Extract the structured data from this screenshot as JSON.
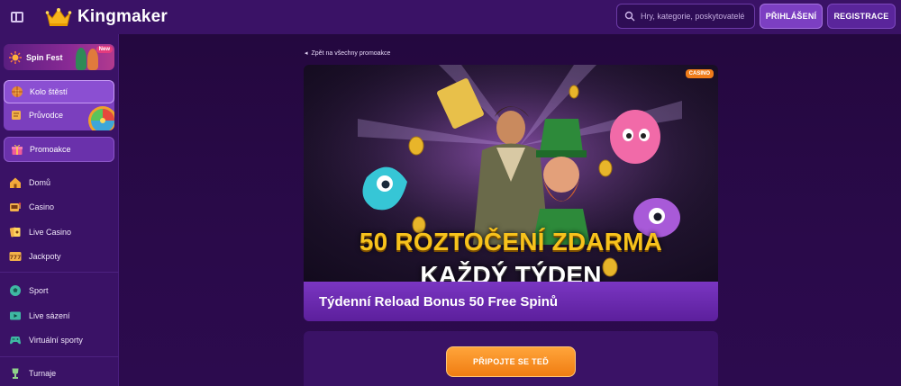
{
  "header": {
    "brand": "Kingmaker",
    "search_placeholder": "Hry, kategorie, poskytovatelé",
    "login_label": "PŘIHLÁŠENÍ",
    "register_label": "REGISTRACE"
  },
  "sidebar": {
    "promo_banner": {
      "label": "Spin Fest",
      "badge": "New"
    },
    "box_items": [
      {
        "label": "Kolo štěstí",
        "icon": "fortune-wheel-icon"
      },
      {
        "label": "Průvodce",
        "icon": "guide-icon"
      }
    ],
    "promotions": {
      "label": "Promoakce",
      "icon": "gift-icon"
    },
    "nav_group1": [
      {
        "label": "Domů",
        "icon": "home-icon"
      },
      {
        "label": "Casino",
        "icon": "slot-icon"
      },
      {
        "label": "Live Casino",
        "icon": "cards-icon"
      },
      {
        "label": "Jackpoty",
        "icon": "jackpot-777-icon"
      }
    ],
    "nav_group2": [
      {
        "label": "Sport",
        "icon": "soccer-ball-icon"
      },
      {
        "label": "Live sázení",
        "icon": "live-tv-icon"
      },
      {
        "label": "Virtuální sporty",
        "icon": "gamepad-icon"
      }
    ],
    "nav_group3": [
      {
        "label": "Turnaje",
        "icon": "trophy-icon"
      }
    ]
  },
  "main": {
    "back_link": "Zpět na všechny promoakce",
    "hero": {
      "badge": "CASINO",
      "line1": "50 ROZTOČENÍ ZDARMA",
      "line2": "KAŽDÝ TÝDEN"
    },
    "promo_title": "Týdenní Reload Bonus 50 Free Spinů",
    "join_button": "PŘIPOJTE SE TEĎ"
  },
  "colors": {
    "background": "#2a0a4a",
    "topbar": "#3a1266",
    "accent_purple": "#7c3fc2",
    "accent_orange": "#f07d12",
    "hero_gold_text": "#f7c21c"
  }
}
